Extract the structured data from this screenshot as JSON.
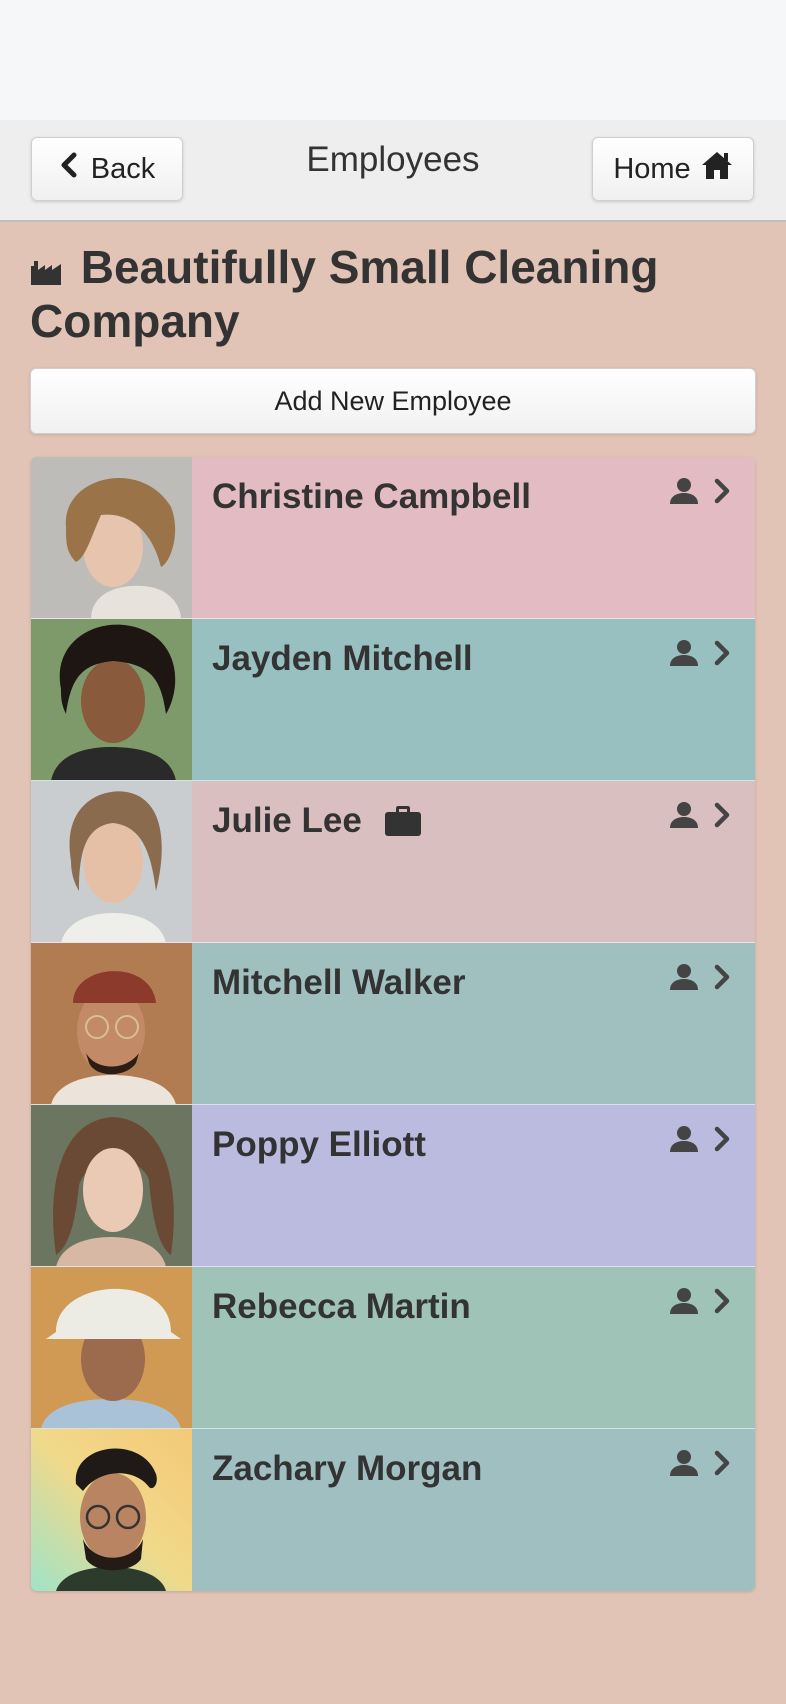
{
  "header": {
    "title": "Employees",
    "back_label": "Back",
    "home_label": "Home"
  },
  "company": {
    "name": "Beautifully Small Cleaning Company",
    "icon": "industry-icon"
  },
  "add_button_label": "Add New Employee",
  "employees": [
    {
      "name": "Christine Campbell",
      "color": "#e3bcc3",
      "has_briefcase": false
    },
    {
      "name": "Jayden Mitchell",
      "color": "#99c0c1",
      "has_briefcase": false
    },
    {
      "name": "Julie Lee",
      "color": "#d9bfbf",
      "has_briefcase": true
    },
    {
      "name": "Mitchell Walker",
      "color": "#a0c0c0",
      "has_briefcase": false
    },
    {
      "name": "Poppy Elliott",
      "color": "#bbbadf",
      "has_briefcase": false
    },
    {
      "name": "Rebecca Martin",
      "color": "#a0c3b7",
      "has_briefcase": false
    },
    {
      "name": "Zachary Morgan",
      "color": "#9fbfc1",
      "has_briefcase": false
    }
  ],
  "row_icons": [
    "person-icon",
    "chevron-right-icon"
  ],
  "colors": {
    "page_background": "#e2c4b7",
    "header_background": "#eeeeee"
  }
}
